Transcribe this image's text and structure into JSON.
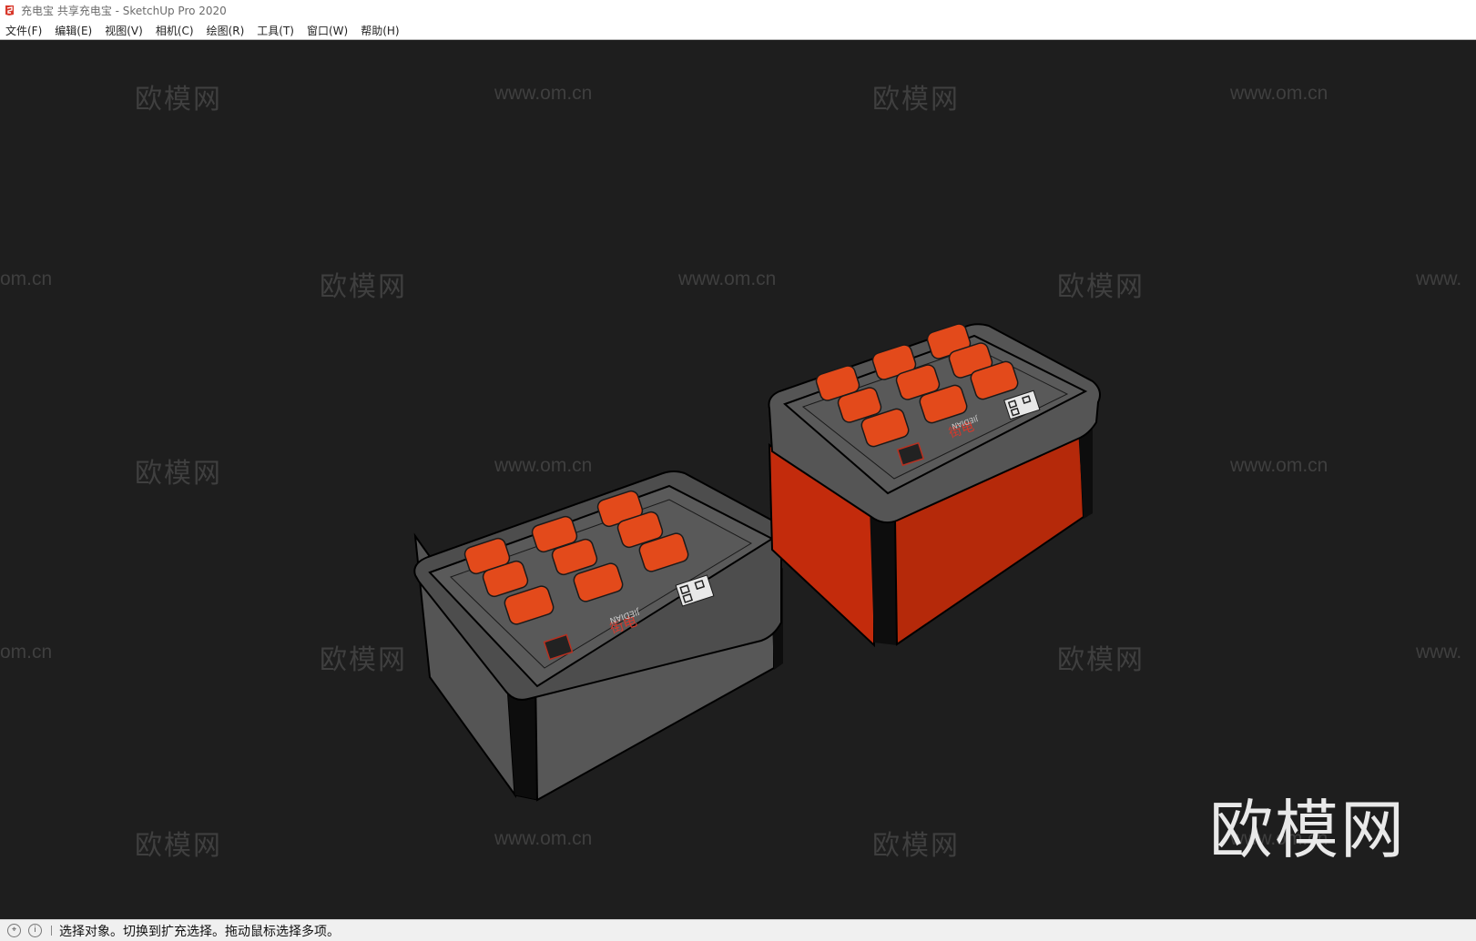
{
  "window": {
    "title": "充电宝 共享充电宝 - SketchUp Pro 2020",
    "app_icon": "sketchup-icon",
    "accent_color": "#d8382b"
  },
  "menu": {
    "items": [
      "文件(F)",
      "编辑(E)",
      "视图(V)",
      "相机(C)",
      "绘图(R)",
      "工具(T)",
      "窗口(W)",
      "帮助(H)"
    ]
  },
  "viewport": {
    "background": "#1e1e1e",
    "watermark_cn": "欧模网",
    "watermark_url": "www.om.cn",
    "watermark_url_partial_left": "om.cn",
    "watermark_url_partial_right": "www.",
    "logo_text": "欧模网",
    "model": {
      "left_unit": {
        "shell_color": "#555555",
        "button_color": "#e34a1b",
        "brand": "JIEDIAN",
        "logo_text": "街电"
      },
      "right_unit": {
        "shell_color": "#c32b0c",
        "button_color": "#e34a1b",
        "brand": "JIEDIAN",
        "logo_text": "街电"
      }
    }
  },
  "statusbar": {
    "icons": [
      "location-icon",
      "info-icon"
    ],
    "text": "选择对象。切换到扩充选择。拖动鼠标选择多项。"
  }
}
